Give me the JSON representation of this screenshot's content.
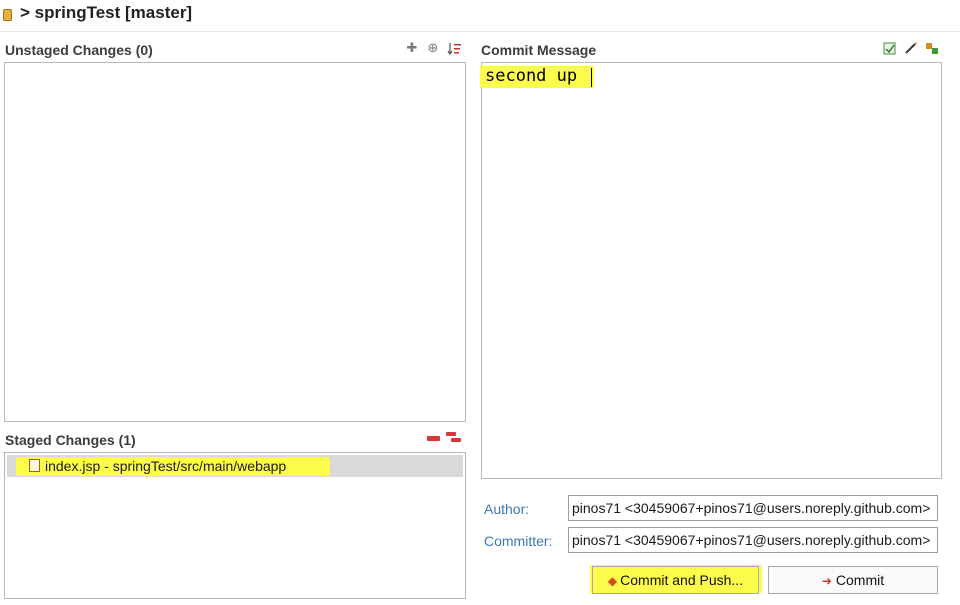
{
  "header": {
    "title": "> springTest [master]"
  },
  "unstaged": {
    "title": "Unstaged Changes (0)",
    "icons": [
      "add-icon",
      "add-all-icon",
      "sort-icon"
    ],
    "icon_glyphs": [
      "✚",
      "⊕",
      "⇂"
    ]
  },
  "staged": {
    "title": "Staged Changes (1)",
    "icons": [
      "remove-icon",
      "remove-all-icon"
    ],
    "items": [
      {
        "label": "index.jsp - springTest/src/main/webapp",
        "icon": "file-icon"
      }
    ]
  },
  "commit_message": {
    "title": "Commit Message",
    "icons": [
      "sign-off-icon",
      "amend-icon",
      "change-id-icon"
    ],
    "text": "second up"
  },
  "author": {
    "label": "Author:",
    "value": "pinos71 <30459067+pinos71@users.noreply.github.com>"
  },
  "committer": {
    "label": "Committer:",
    "value": "pinos71 <30459067+pinos71@users.noreply.github.com>"
  },
  "buttons": {
    "commit_and_push": "Commit and Push...",
    "commit": "Commit"
  },
  "colors": {
    "highlight": "#fcfc4a",
    "label_blue": "#3a79b5",
    "selection": "#d9d9d9",
    "remove_red": "#d23a3a"
  }
}
